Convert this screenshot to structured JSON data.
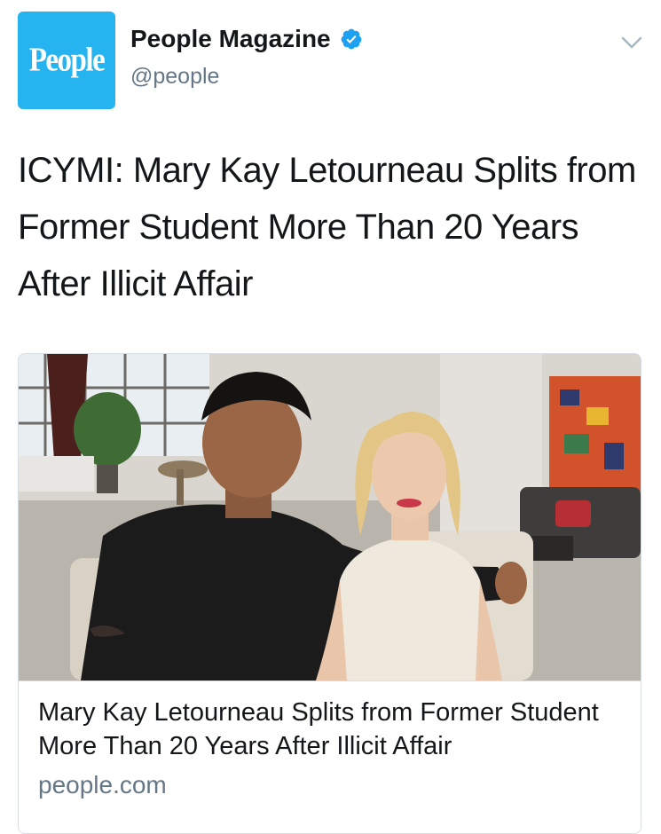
{
  "account": {
    "avatar_text": "People",
    "display_name": "People Magazine",
    "handle": "@people",
    "verified": true,
    "brand_color": "#25b4f0",
    "verified_color": "#1da1f2"
  },
  "tweet": {
    "text": "ICYMI: Mary Kay Letourneau Splits from Former Student More Than 20 Years After Illicit Affair"
  },
  "card": {
    "image_icon": "photo-of-couple",
    "title": "Mary Kay Letourneau Splits from Former Student More Than 20 Years After Illicit Affair",
    "domain": "people.com"
  },
  "icons": {
    "menu": "chevron-down-icon",
    "verified": "verified-badge-icon"
  }
}
